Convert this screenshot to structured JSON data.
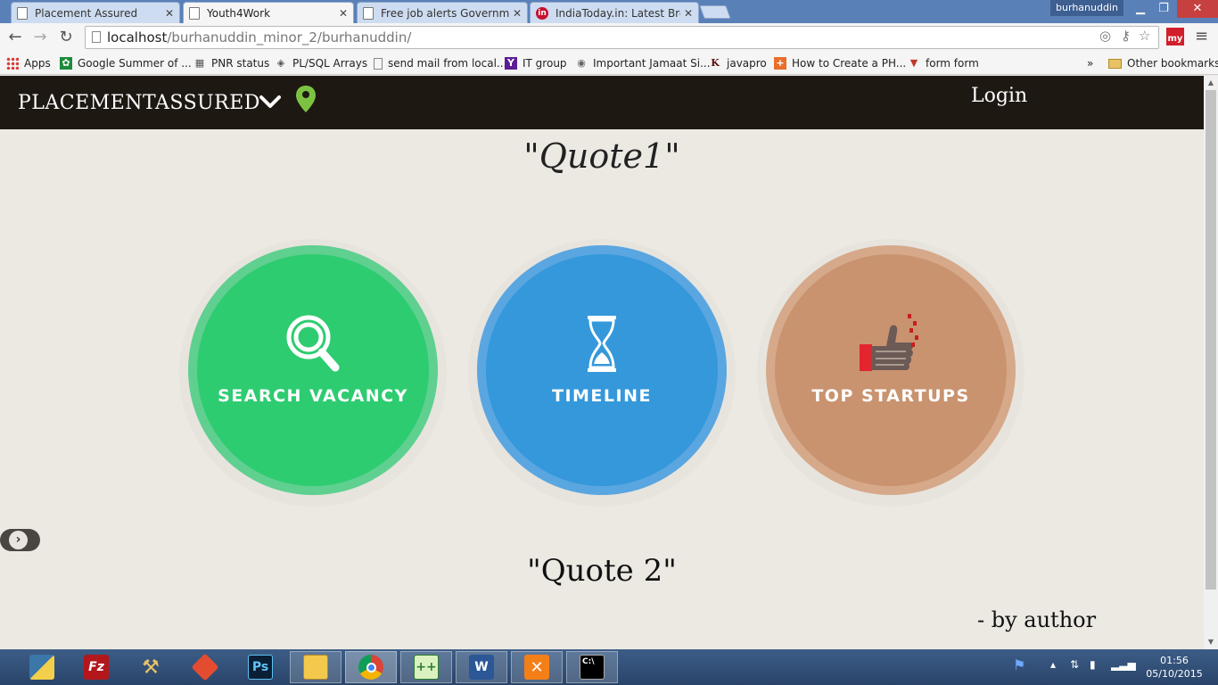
{
  "tabs": [
    {
      "label": "Placement Assured",
      "active": false
    },
    {
      "label": "Youth4Work",
      "active": true
    },
    {
      "label": "Free job alerts Governmen",
      "active": false
    },
    {
      "label": "IndiaToday.in: Latest Break",
      "active": false
    }
  ],
  "tab_close": "✕",
  "user_badge": "burhanuddin",
  "address": {
    "host": "localhost",
    "path": "/burhanuddin_minor_2/burhanuddin/"
  },
  "ext_label": "my",
  "bookmarks": [
    {
      "label": "Apps"
    },
    {
      "label": "Google Summer of ..."
    },
    {
      "label": "PNR status"
    },
    {
      "label": "PL/SQL Arrays"
    },
    {
      "label": "send mail from local..."
    },
    {
      "label": "IT group"
    },
    {
      "label": "Important Jamaat Si..."
    },
    {
      "label": "javapro"
    },
    {
      "label": "How to Create a PH..."
    },
    {
      "label": "form form"
    }
  ],
  "bookmarks_overflow": "»",
  "other_bookmarks": "Other bookmarks",
  "site": {
    "brand_part1": "PLACEMENT",
    "brand_part2": "ASSURED",
    "login": "Login",
    "quote1": "\"Quote1\"",
    "quote2": "\"Quote 2\"",
    "author": "- by author",
    "slider_arrow": "›",
    "cards": [
      {
        "label": "SEARCH VACANCY",
        "icon": "magnifier-icon",
        "color": "#2ecc71"
      },
      {
        "label": "TIMELINE",
        "icon": "hourglass-icon",
        "color": "#3498db"
      },
      {
        "label": "TOP STARTUPS",
        "icon": "thumbs-up-collage-icon",
        "color": "#c9936f"
      }
    ]
  },
  "taskbar": {
    "apps": [
      "python-icon",
      "filezilla-icon",
      "tools-icon",
      "git-icon",
      "photoshop-icon",
      "file-explorer-icon",
      "chrome-icon",
      "notepad-plus-icon",
      "word-icon",
      "xampp-icon",
      "cmd-icon"
    ],
    "clock_time": "01:56",
    "clock_date": "05/10/2015"
  }
}
